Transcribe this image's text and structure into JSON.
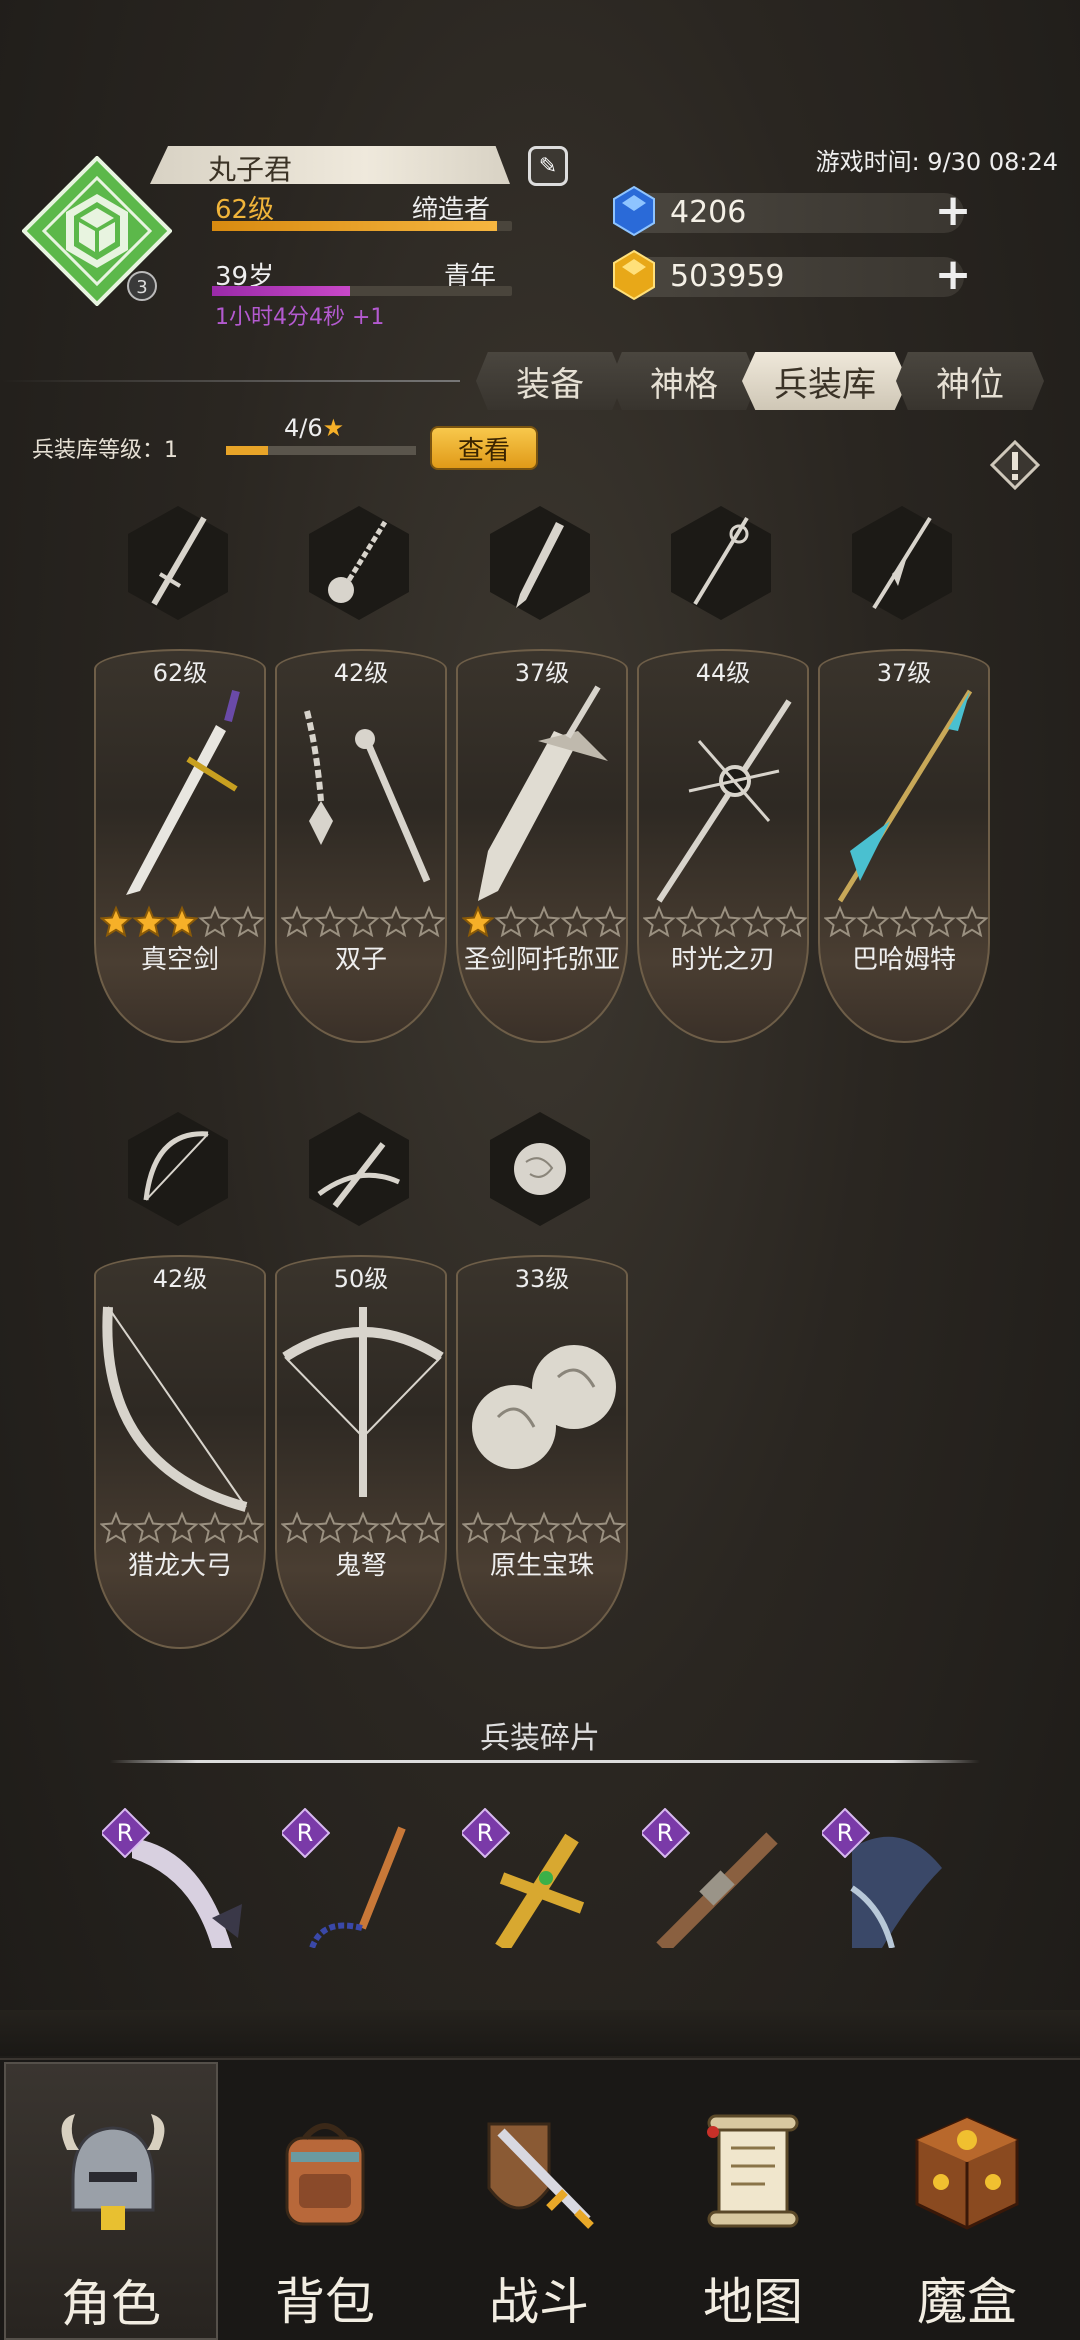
{
  "player": {
    "name": "丸子君",
    "level": "62级",
    "class": "缔造者",
    "level_progress": 0.95,
    "age": "39岁",
    "stage": "青年",
    "age_progress": 0.46,
    "timer": "1小时4分4秒 +1",
    "rank_badge": "3"
  },
  "game_time": "游戏时间: 9/30 08:24",
  "resources": {
    "gems": "4206",
    "gold": "503959"
  },
  "tabs": [
    "装备",
    "神格",
    "兵装库",
    "神位"
  ],
  "active_tab": 2,
  "armory": {
    "level_label": "兵装库等级：1",
    "progress_text": "4/6",
    "progress": 0.22,
    "view_button": "查看"
  },
  "weapons": [
    {
      "level": "62级",
      "name": "真空剑",
      "stars": 3
    },
    {
      "level": "42级",
      "name": "双子",
      "stars": 0
    },
    {
      "level": "37级",
      "name": "圣剑阿托弥亚",
      "stars": 1
    },
    {
      "level": "44级",
      "name": "时光之刃",
      "stars": 0
    },
    {
      "level": "37级",
      "name": "巴哈姆特",
      "stars": 0
    },
    {
      "level": "42级",
      "name": "猎龙大弓",
      "stars": 0
    },
    {
      "level": "50级",
      "name": "鬼弩",
      "stars": 0
    },
    {
      "level": "33级",
      "name": "原生宝珠",
      "stars": 0
    }
  ],
  "shards": {
    "title": "兵装碎片",
    "items": [
      {
        "rarity": "R",
        "icon": "scimitar-shard-icon"
      },
      {
        "rarity": "R",
        "icon": "flail-shard-icon"
      },
      {
        "rarity": "R",
        "icon": "golden-sword-shard-icon"
      },
      {
        "rarity": "R",
        "icon": "pistol-shard-icon"
      },
      {
        "rarity": "R",
        "icon": "axe-shard-icon"
      }
    ]
  },
  "nav": [
    {
      "label": "角色",
      "icon": "helmet-icon"
    },
    {
      "label": "背包",
      "icon": "backpack-icon"
    },
    {
      "label": "战斗",
      "icon": "sword-shield-icon"
    },
    {
      "label": "地图",
      "icon": "scroll-map-icon"
    },
    {
      "label": "魔盒",
      "icon": "magic-box-icon"
    }
  ],
  "active_nav": 0,
  "colors": {
    "gold_accent": "#f0b43a",
    "purple_accent": "#b45ad0",
    "emblem_green": "#5cb84a",
    "rarity_purple": "#7a3aa8"
  }
}
